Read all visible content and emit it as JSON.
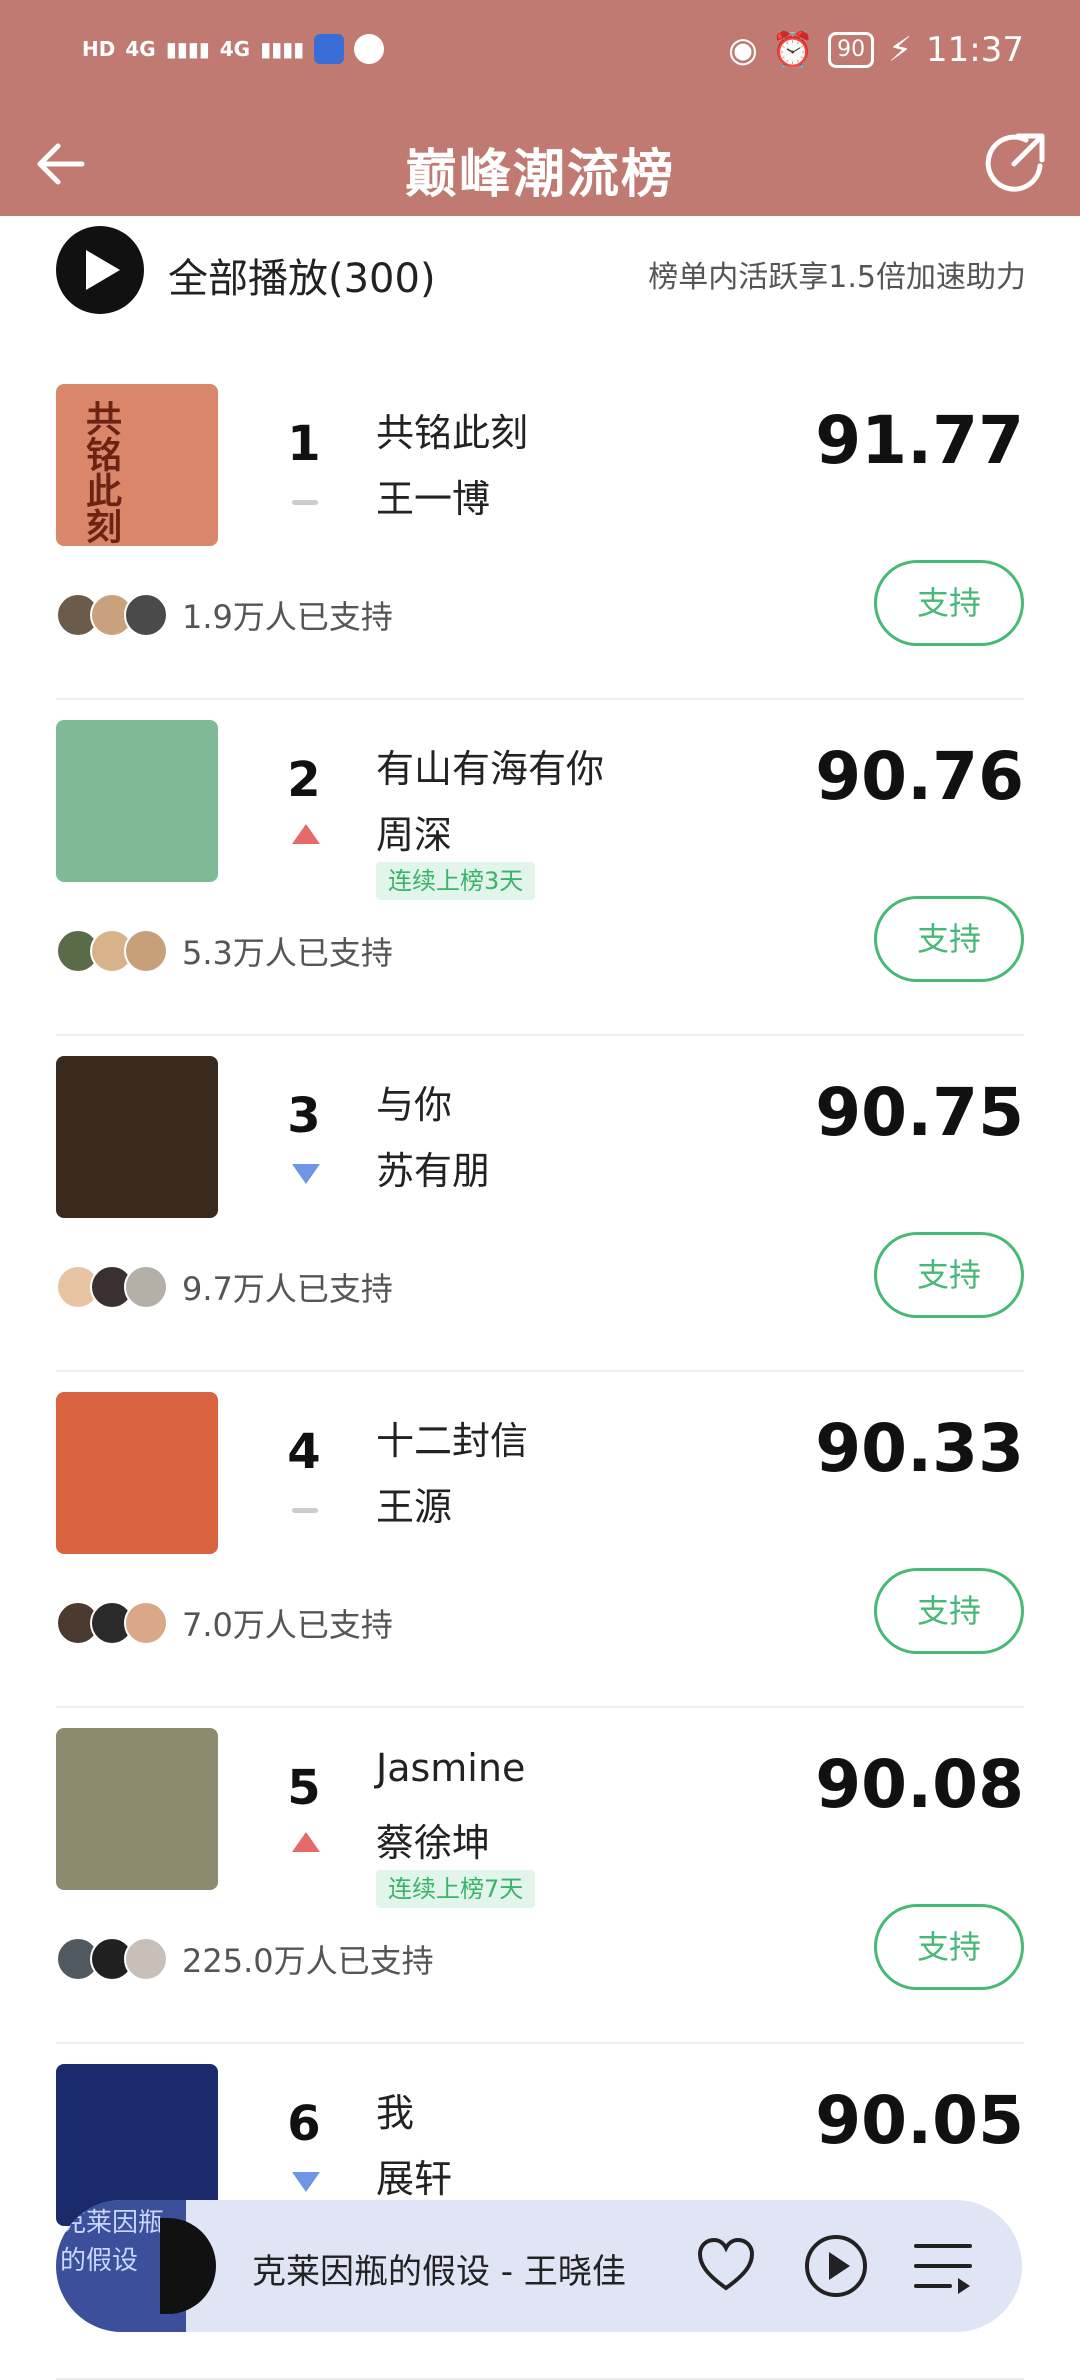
{
  "status_bar": {
    "network1": "4G",
    "network2": "4G",
    "battery": "90",
    "time": "11:37",
    "hd1": "HD",
    "hd2": "HD"
  },
  "header": {
    "title": "巅峰潮流榜"
  },
  "play_all": {
    "label": "全部播放(300)",
    "hint": "榜单内活跃享1.5倍加速助力"
  },
  "support_label": "支持",
  "items": [
    {
      "rank": "1",
      "trend": "same",
      "song": "共铭此刻",
      "artist": "王一博",
      "badge": "",
      "score": "91.77",
      "supporters": "1.9万人已支持",
      "cover_color": "#d9866a",
      "cover_text": "共铭此刻"
    },
    {
      "rank": "2",
      "trend": "up",
      "song": "有山有海有你",
      "artist": "周深",
      "badge": "连续上榜3天",
      "score": "90.76",
      "supporters": "5.3万人已支持",
      "cover_color": "#7fb995",
      "cover_text": ""
    },
    {
      "rank": "3",
      "trend": "down",
      "song": "与你",
      "artist": "苏有朋",
      "badge": "",
      "score": "90.75",
      "supporters": "9.7万人已支持",
      "cover_color": "#3a2a1e",
      "cover_text": ""
    },
    {
      "rank": "4",
      "trend": "same",
      "song": "十二封信",
      "artist": "王源",
      "badge": "",
      "score": "90.33",
      "supporters": "7.0万人已支持",
      "cover_color": "#d9633f",
      "cover_text": ""
    },
    {
      "rank": "5",
      "trend": "up",
      "song": "Jasmine",
      "artist": "蔡徐坤",
      "badge": "连续上榜7天",
      "score": "90.08",
      "supporters": "225.0万人已支持",
      "cover_color": "#8c8a6f",
      "cover_text": ""
    },
    {
      "rank": "6",
      "trend": "down",
      "song": "我",
      "artist": "展轩",
      "badge": "",
      "score": "90.05",
      "supporters": "",
      "cover_color": "#1a2a6b",
      "cover_text": ""
    }
  ],
  "player": {
    "title": "克莱因瓶的假设 - 王晓佳",
    "cover_text": "克莱因瓶的假设"
  },
  "colors": {
    "header_bg": "#c07a72",
    "accent_green": "#46b877",
    "trend_up": "#e56b6b",
    "trend_down": "#6f95e6"
  }
}
